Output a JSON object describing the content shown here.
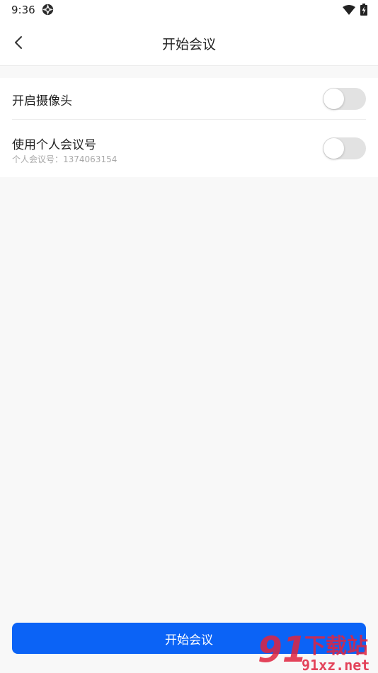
{
  "status_bar": {
    "time": "9:36",
    "icons": [
      "aperture-icon",
      "wifi-icon",
      "battery-charging-icon"
    ]
  },
  "nav": {
    "title": "开始会议",
    "back_icon": "chevron-left-icon"
  },
  "settings": {
    "camera": {
      "label": "开启摄像头",
      "enabled": false
    },
    "personal_meeting_id": {
      "label": "使用个人会议号",
      "sub_label": "个人会议号：1374063154",
      "enabled": false
    }
  },
  "actions": {
    "start_label": "开始会议"
  },
  "watermark": {
    "text_top": "下载站",
    "text_bottom": "91xz.net",
    "logo_text": "91"
  },
  "colors": {
    "accent": "#0b63f6",
    "toggle_off": "#e2e2e2",
    "watermark": "#e0243f"
  }
}
